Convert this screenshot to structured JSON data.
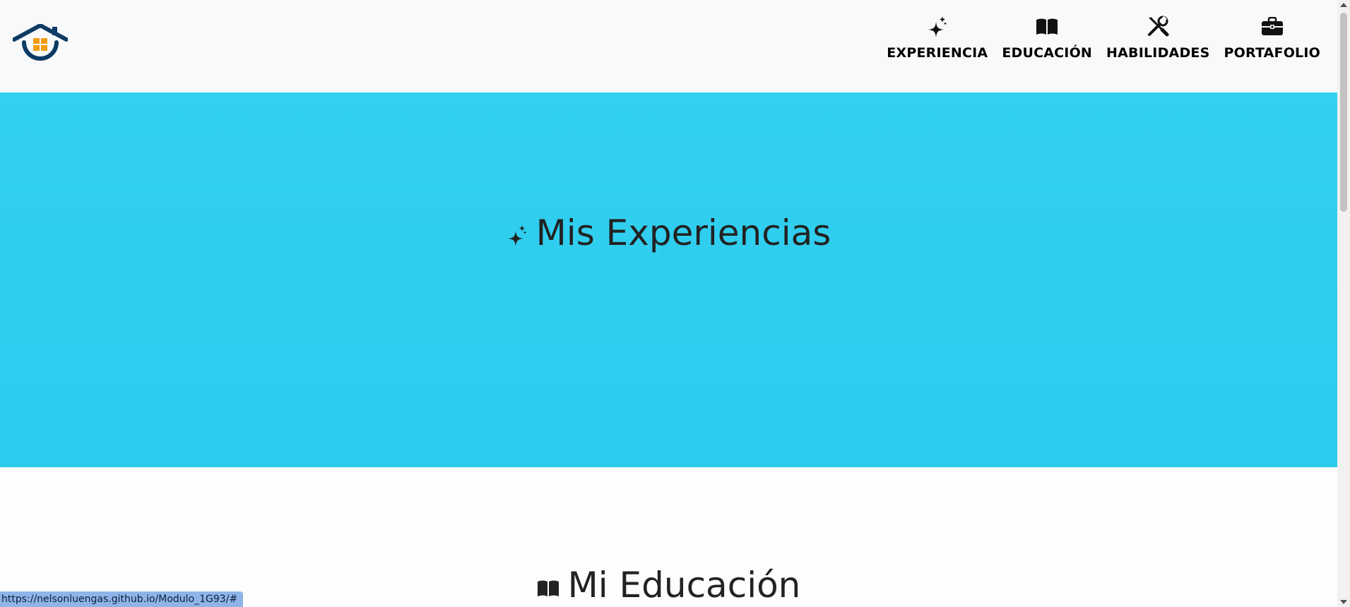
{
  "navbar": {
    "brand": {
      "icon": "house-logo-icon"
    },
    "items": [
      {
        "label": "EXPERIENCIA",
        "icon": "sparkles-icon"
      },
      {
        "label": "EDUCACIÓN",
        "icon": "book-icon"
      },
      {
        "label": "HABILIDADES",
        "icon": "tools-icon"
      },
      {
        "label": "PORTAFOLIO",
        "icon": "briefcase-icon"
      }
    ]
  },
  "hero": {
    "title": "Mis Experiencias",
    "icon": "sparkles-icon",
    "background": "#2fcdee"
  },
  "education": {
    "title": "Mi Educación",
    "icon": "book-icon"
  },
  "status_bar": {
    "url": "https://nelsonluengas.github.io/Modulo_1G93/#"
  },
  "colors": {
    "navbar_bg": "#f8f9fa",
    "logo_blue": "#0d3b66",
    "logo_orange": "#f39c12",
    "text_dark": "#222222"
  }
}
